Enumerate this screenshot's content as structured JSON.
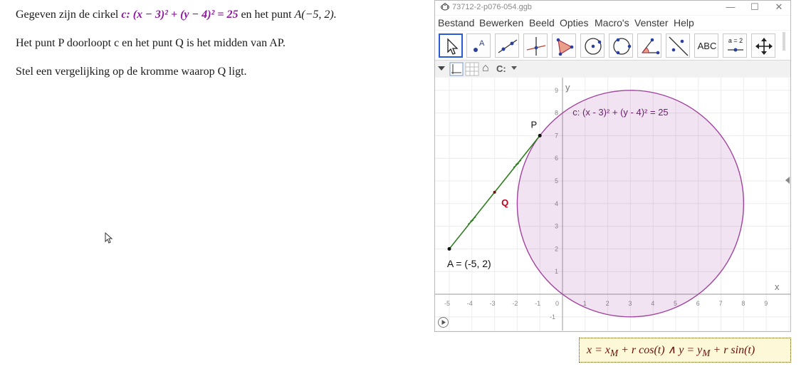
{
  "problem": {
    "line1_prefix": "Gegeven zijn de cirkel ",
    "line1_circle": "c: (x − 3)² + (y − 4)² = 25",
    "line1_mid": " en het punt ",
    "line1_point": "A(−5, 2).",
    "line2": "Het punt P doorloopt c en het punt Q is het midden van AP.",
    "line3": "Stel een vergelijking op de kromme waarop Q  ligt."
  },
  "window": {
    "title": "73712-2-p076-054.ggb",
    "min_glyph": "—",
    "max_glyph": "☐",
    "close_glyph": "✕"
  },
  "menu": [
    "Bestand",
    "Bewerken",
    "Beeld",
    "Opties",
    "Macro's",
    "Venster",
    "Help"
  ],
  "toolbar": {
    "tools": [
      "move-tool",
      "point-tool",
      "line-tool",
      "perpendicular-tool",
      "polygon-tool",
      "circle-center-tool",
      "circle-three-points-tool",
      "angle-tool",
      "reflect-tool",
      "text-tool",
      "slider-tool",
      "move-graphics-tool"
    ],
    "text_tool_label": "ABC",
    "slider_tool_label": "a = 2"
  },
  "stylebar": {
    "home_glyph": "⌂",
    "view_label": "C:"
  },
  "graphics": {
    "circle_label": "c: (x - 3)² + (y - 4)² = 25",
    "point_A_label": "A = (-5, 2)",
    "point_P_label": "P",
    "point_Q_label": "Q",
    "x_axis_label": "x",
    "y_axis_label": "y",
    "x_ticks": [
      "-5",
      "-4",
      "-3",
      "-2",
      "-1",
      "0",
      "1",
      "2",
      "3",
      "4",
      "5",
      "6",
      "7",
      "8",
      "9"
    ],
    "y_ticks": [
      "-1",
      "1",
      "2",
      "3",
      "4",
      "5",
      "6",
      "7",
      "8",
      "9"
    ],
    "circle_color": "#a1449e",
    "segment_color": "#2e7d1e",
    "q_color": "#c0001e"
  },
  "formula": "x = x_M + r cos(t) ∧ y = y_M + r sin(t)",
  "formula_parts": {
    "a": "x = x",
    "a_sub": "M",
    "b": " + r cos(t) ∧ y = y",
    "b_sub": "M",
    "c": " + r sin(t)"
  }
}
